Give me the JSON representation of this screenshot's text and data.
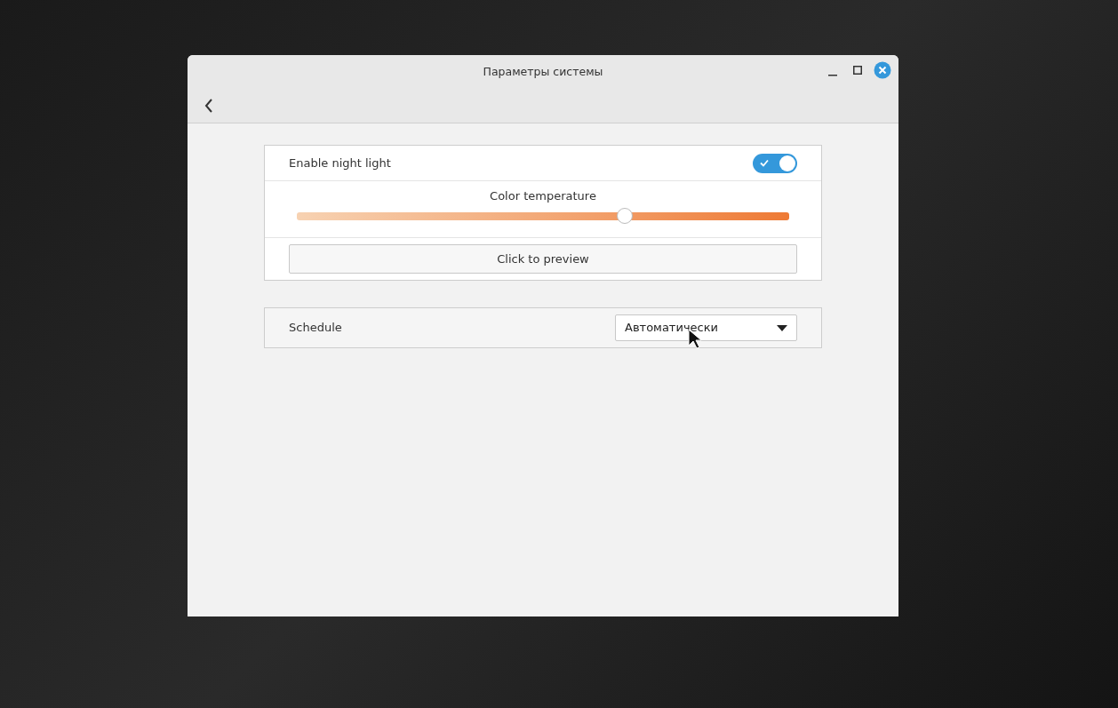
{
  "window": {
    "title": "Параметры системы"
  },
  "night_light": {
    "label": "Enable night light",
    "on": true
  },
  "color_temperature": {
    "label": "Color temperature",
    "level": 0.666
  },
  "preview_button": {
    "label": "Click to preview"
  },
  "schedule": {
    "label": "Schedule",
    "value": "Автоматически"
  }
}
